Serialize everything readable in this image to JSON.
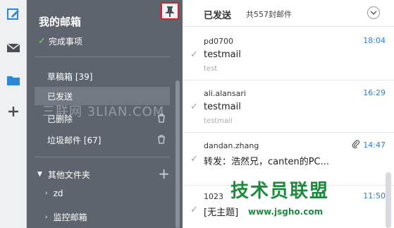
{
  "rail": {
    "icons": [
      "compose-icon",
      "mail-icon",
      "folder-icon",
      "add-icon"
    ]
  },
  "sidebar": {
    "title": "我的邮箱",
    "todo_label": "完成事项",
    "items": [
      {
        "label": "草稿箱 [39]"
      },
      {
        "label": "已发送"
      },
      {
        "label": "已删除"
      },
      {
        "label": "垃圾邮件 [67]"
      }
    ],
    "folders_label": "其他文件夹",
    "sub_folders": [
      {
        "label": "zd"
      },
      {
        "label": "监控邮箱"
      }
    ]
  },
  "watermark": "三联网 3LIAN.COM",
  "main": {
    "title": "已发送",
    "count": "共557封邮件",
    "mails": [
      {
        "sender": "pd0700",
        "time": "18:04",
        "subject": "testmail",
        "preview": "test",
        "attachment": false
      },
      {
        "sender": "ali.alansari",
        "time": "16:29",
        "subject": "testmail",
        "preview": "testmail",
        "attachment": false
      },
      {
        "sender": "dandan.zhang",
        "time": "14:47",
        "subject": "转发：浩然兄，canten的PC...",
        "preview": "",
        "attachment": true
      },
      {
        "sender": "1023",
        "time": "11:50",
        "subject": "[无主题]",
        "preview": "",
        "attachment": false
      }
    ]
  },
  "stamp": {
    "text": "技术员联盟",
    "url": "www.jsgho.com"
  },
  "colors": {
    "sidebar_bg": "#5d646d",
    "accent_time": "#2e7ec6",
    "pin_border": "#d8202a",
    "check_green": "#7fd36b"
  }
}
